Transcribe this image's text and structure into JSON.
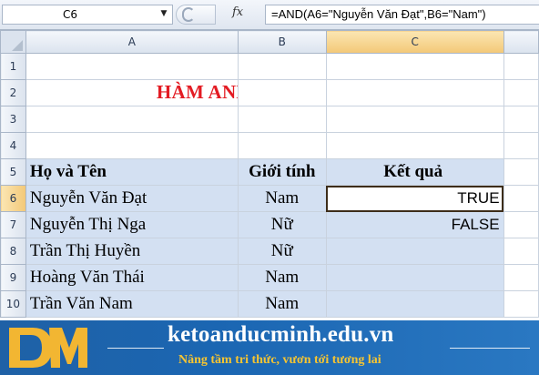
{
  "formula_bar": {
    "name_box": "C6",
    "fx_label": "fx",
    "formula": "=AND(A6=\"Nguyễn Văn Đạt\",B6=\"Nam\")"
  },
  "columns": [
    "A",
    "B",
    "C"
  ],
  "rows": [
    "1",
    "2",
    "3",
    "4",
    "5",
    "6",
    "7",
    "8",
    "9",
    "10"
  ],
  "sheet": {
    "title": "HÀM AND TRONG EXCEL",
    "headers": {
      "name": "Họ và Tên",
      "gender": "Giới tính",
      "result": "Kết quả"
    },
    "data": [
      {
        "name": "Nguyễn Văn Đạt",
        "gender": "Nam",
        "result": "TRUE"
      },
      {
        "name": "Nguyễn Thị Nga",
        "gender": "Nữ",
        "result": "FALSE"
      },
      {
        "name": "Trần Thị Huyền",
        "gender": "Nữ",
        "result": ""
      },
      {
        "name": "Hoàng Văn Thái",
        "gender": "Nam",
        "result": ""
      },
      {
        "name": "Trần Văn Nam",
        "gender": "Nam",
        "result": ""
      }
    ]
  },
  "banner": {
    "site": "ketoanducminh.edu.vn",
    "slogan": "Nâng tầm tri thức, vươn tới tương lai",
    "colors": {
      "background": "#1b66b2",
      "slogan": "#f7c531",
      "logo": "#f2b632"
    }
  },
  "accent": {
    "title_red": "#e31b23",
    "header_blue": "#d3e0f2",
    "selected_header": "#f3c877"
  }
}
